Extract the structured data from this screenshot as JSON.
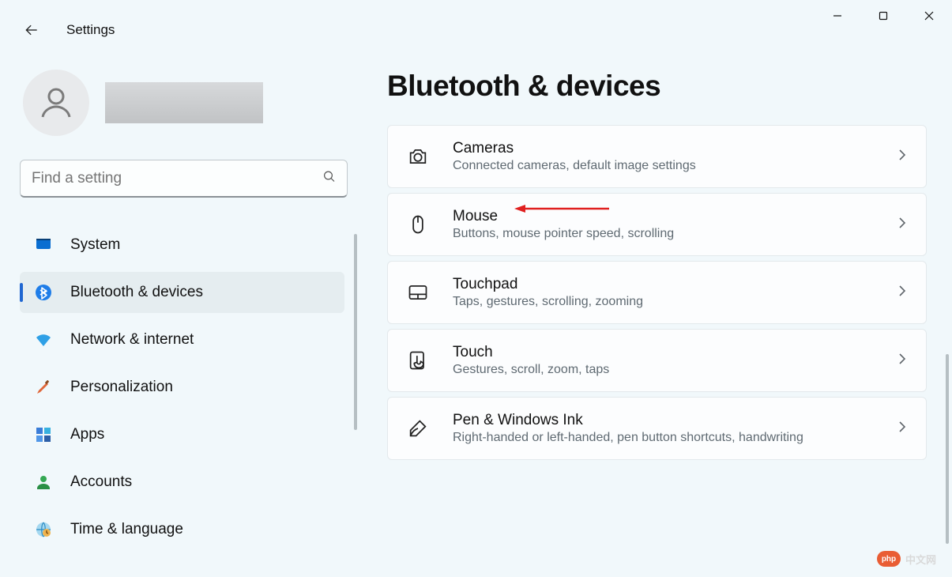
{
  "app": {
    "title": "Settings"
  },
  "search": {
    "placeholder": "Find a setting"
  },
  "sidebar": {
    "items": [
      {
        "label": "System"
      },
      {
        "label": "Bluetooth & devices"
      },
      {
        "label": "Network & internet"
      },
      {
        "label": "Personalization"
      },
      {
        "label": "Apps"
      },
      {
        "label": "Accounts"
      },
      {
        "label": "Time & language"
      }
    ],
    "active_index": 1
  },
  "page": {
    "title": "Bluetooth & devices"
  },
  "cards": [
    {
      "title": "Cameras",
      "subtitle": "Connected cameras, default image settings"
    },
    {
      "title": "Mouse",
      "subtitle": "Buttons, mouse pointer speed, scrolling"
    },
    {
      "title": "Touchpad",
      "subtitle": "Taps, gestures, scrolling, zooming"
    },
    {
      "title": "Touch",
      "subtitle": "Gestures, scroll, zoom, taps"
    },
    {
      "title": "Pen & Windows Ink",
      "subtitle": "Right-handed or left-handed, pen button shortcuts, handwriting"
    }
  ],
  "watermark": {
    "logo": "php",
    "text": "中文网"
  }
}
